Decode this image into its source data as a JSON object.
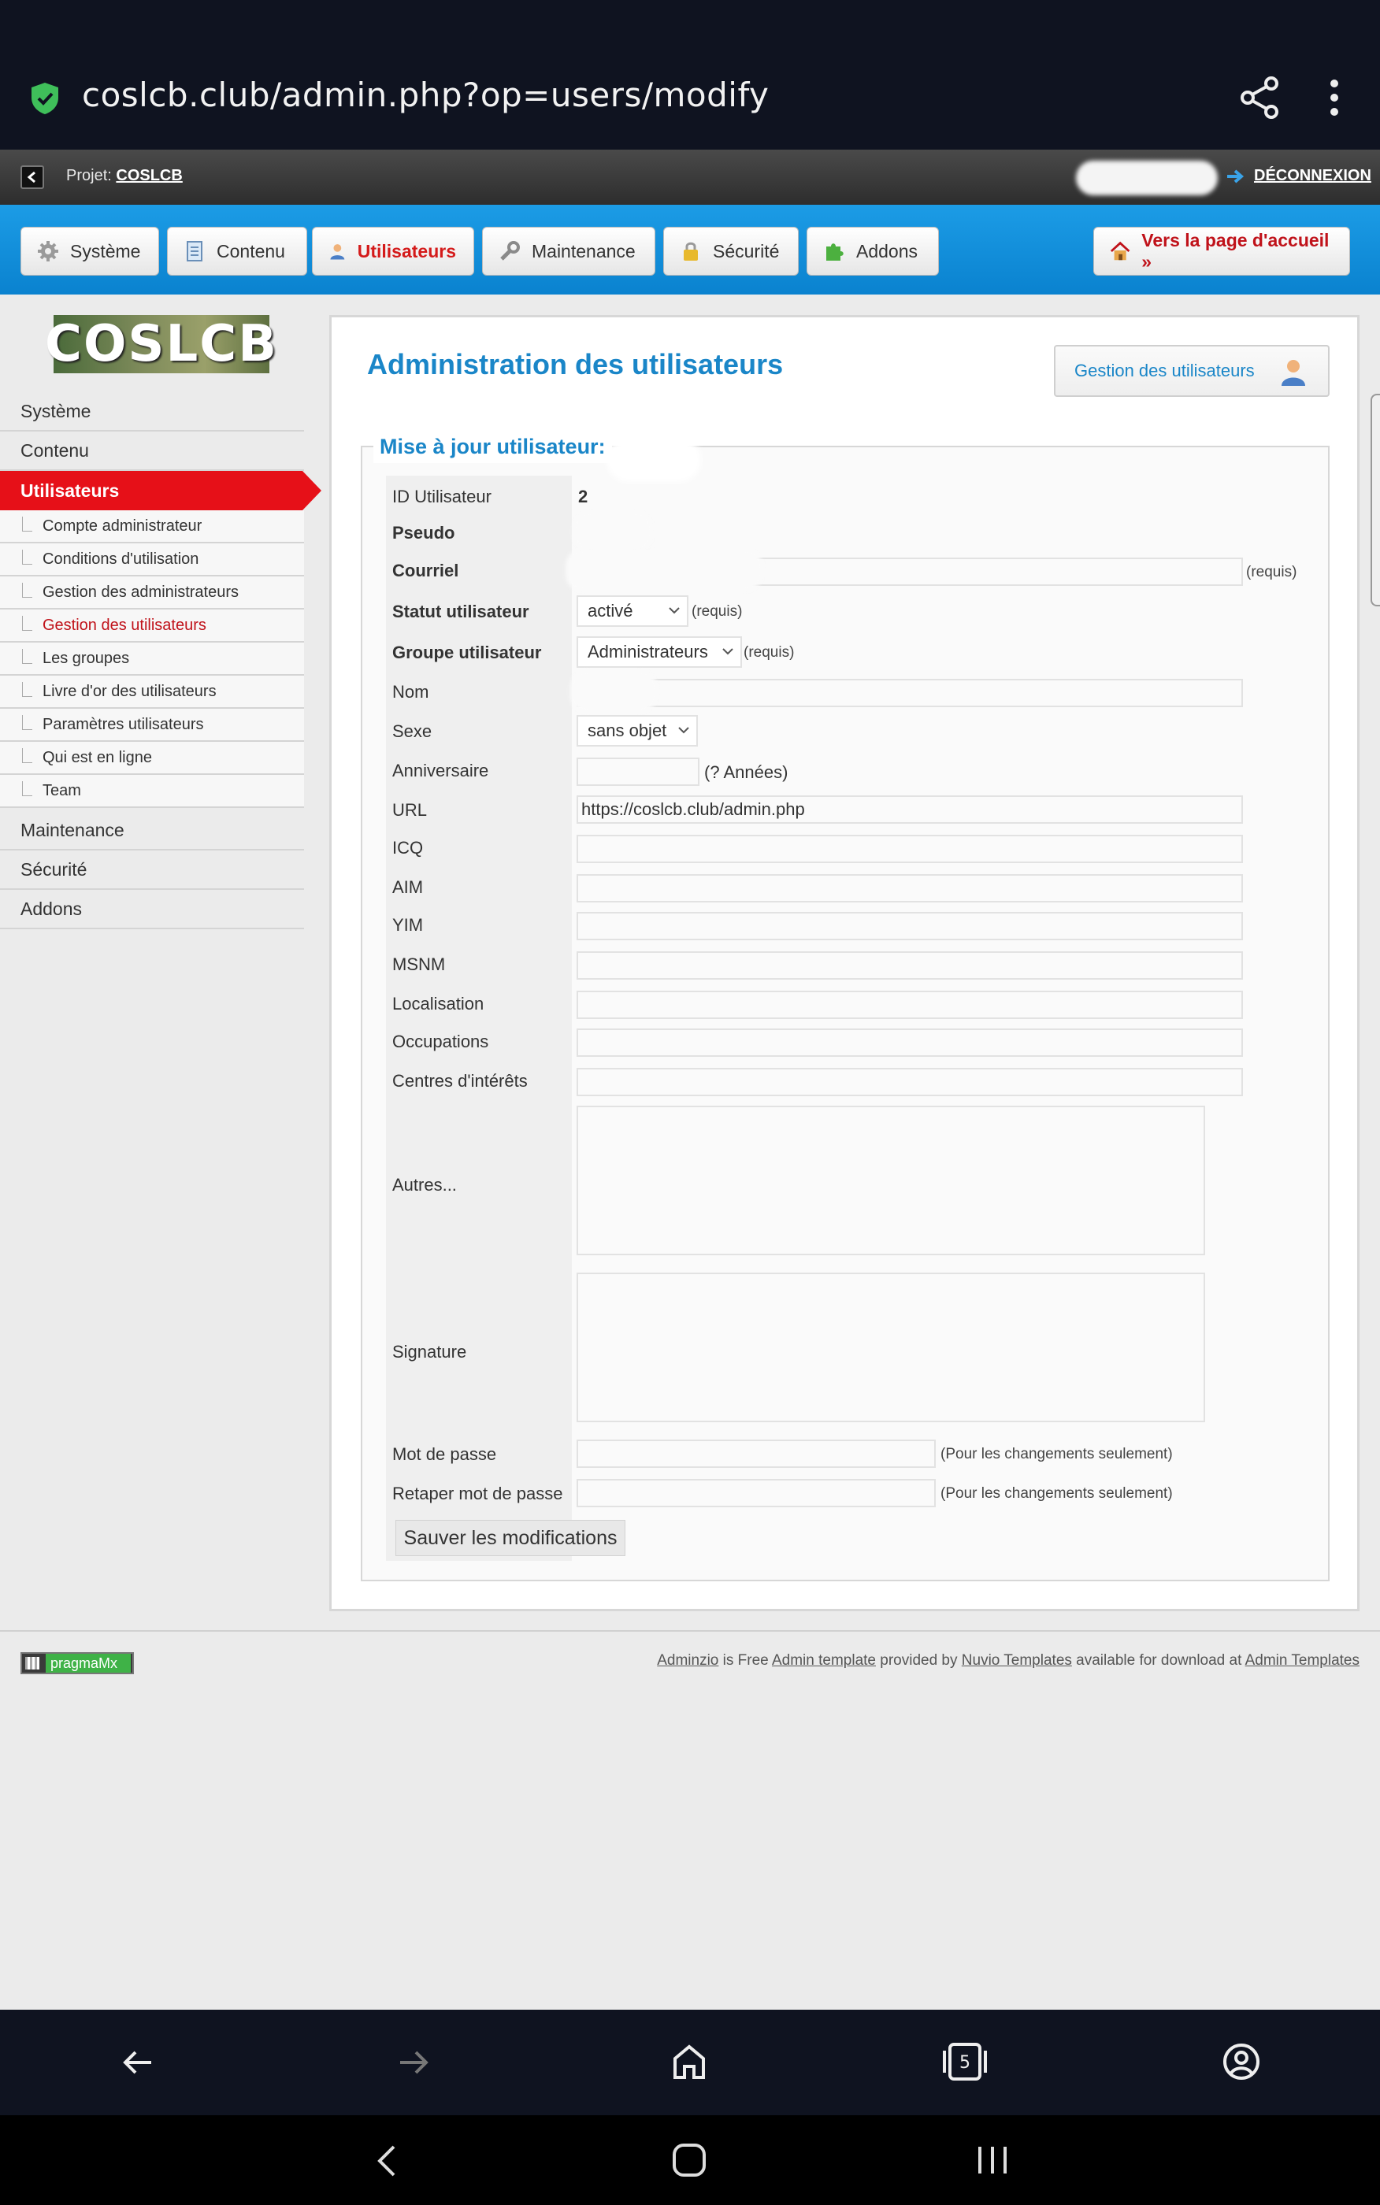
{
  "browser": {
    "url": "coslcb.club/admin.php?op=users/modify"
  },
  "project_bar": {
    "label": "Projet:",
    "project_link": "COSLCB",
    "logout": "DÉCONNEXION"
  },
  "top_nav": {
    "items": [
      {
        "label": "Système",
        "icon": "gear-icon"
      },
      {
        "label": "Contenu",
        "icon": "page-icon"
      },
      {
        "label": "Utilisateurs",
        "icon": "user-icon"
      },
      {
        "label": "Maintenance",
        "icon": "wrench-icon"
      },
      {
        "label": "Sécurité",
        "icon": "lock-icon"
      },
      {
        "label": "Addons",
        "icon": "puzzle-icon"
      }
    ],
    "active": "Utilisateurs",
    "home_button": "Vers la page d'accueil »"
  },
  "sidebar": {
    "logo_text": "COSLCB",
    "items": [
      {
        "label": "Système"
      },
      {
        "label": "Contenu"
      },
      {
        "label": "Utilisateurs"
      },
      {
        "label": "Maintenance"
      },
      {
        "label": "Sécurité"
      },
      {
        "label": "Addons"
      }
    ],
    "sub_items": [
      {
        "label": "Compte administrateur"
      },
      {
        "label": "Conditions d'utilisation"
      },
      {
        "label": "Gestion des administrateurs"
      },
      {
        "label": "Gestion des utilisateurs"
      },
      {
        "label": "Les groupes"
      },
      {
        "label": "Livre d'or des utilisateurs"
      },
      {
        "label": "Paramètres utilisateurs"
      },
      {
        "label": "Qui est en ligne"
      },
      {
        "label": "Team"
      }
    ]
  },
  "main": {
    "title": "Administration des utilisateurs",
    "manage_button": "Gestion des utilisateurs",
    "legend": "Mise à jour utilisateur:",
    "fields": {
      "id_label": "ID Utilisateur",
      "id_value": "2",
      "pseudo_label": "Pseudo",
      "email_label": "Courriel",
      "email_hint": "(requis)",
      "status_label": "Statut utilisateur",
      "status_value": "activé",
      "status_hint": "(requis)",
      "group_label": "Groupe utilisateur",
      "group_value": "Administrateurs",
      "group_hint": "(requis)",
      "name_label": "Nom",
      "sex_label": "Sexe",
      "sex_value": "sans objet",
      "birthday_label": "Anniversaire",
      "birthday_hint": "(? Années)",
      "url_label": "URL",
      "url_value": "https://coslcb.club/admin.php",
      "icq_label": "ICQ",
      "aim_label": "AIM",
      "yim_label": "YIM",
      "msnm_label": "MSNM",
      "location_label": "Localisation",
      "occupation_label": "Occupations",
      "interests_label": "Centres d'intérêts",
      "other_label": "Autres...",
      "signature_label": "Signature",
      "password_label": "Mot de passe",
      "password_hint": "(Pour les changements seulement)",
      "password2_label": "Retaper mot de passe",
      "password2_hint": "(Pour les changements seulement)"
    },
    "save_button": "Sauver les modifications"
  },
  "footer": {
    "badge": "pragmaMx",
    "credits": {
      "adminzio": "Adminzio",
      "t1": " is Free ",
      "admin_template": "Admin template",
      "t2": " provided by ",
      "nuvio": "Nuvio Templates",
      "t3": " available for download at ",
      "admin_templates": "Admin Templates"
    }
  },
  "android_nav": {
    "tab_count": "5"
  }
}
